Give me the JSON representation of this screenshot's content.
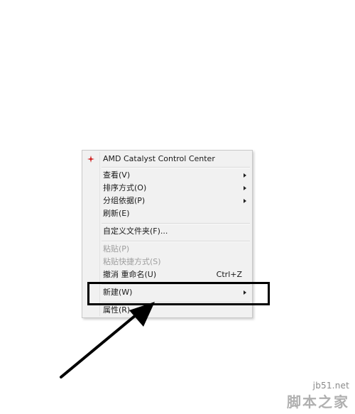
{
  "context_menu": {
    "items": [
      {
        "label": "AMD Catalyst Control Center",
        "icon": "amd-catalyst-icon"
      },
      {
        "label": "查看(V)",
        "submenu": true
      },
      {
        "label": "排序方式(O)",
        "submenu": true
      },
      {
        "label": "分组依据(P)",
        "submenu": true
      },
      {
        "label": "刷新(E)"
      },
      {
        "label": "自定义文件夹(F)..."
      },
      {
        "label": "粘贴(P)",
        "disabled": true
      },
      {
        "label": "粘贴快捷方式(S)",
        "disabled": true
      },
      {
        "label": "撤消 重命名(U)",
        "shortcut": "Ctrl+Z"
      },
      {
        "label": "新建(W)",
        "submenu": true,
        "highlighted": true
      },
      {
        "label": "属性(R)"
      }
    ]
  },
  "annotation": {
    "highlight_color": "#000000",
    "arrow_color": "#000000"
  },
  "watermark": {
    "url": "jb51.net",
    "name": "脚本之家"
  }
}
